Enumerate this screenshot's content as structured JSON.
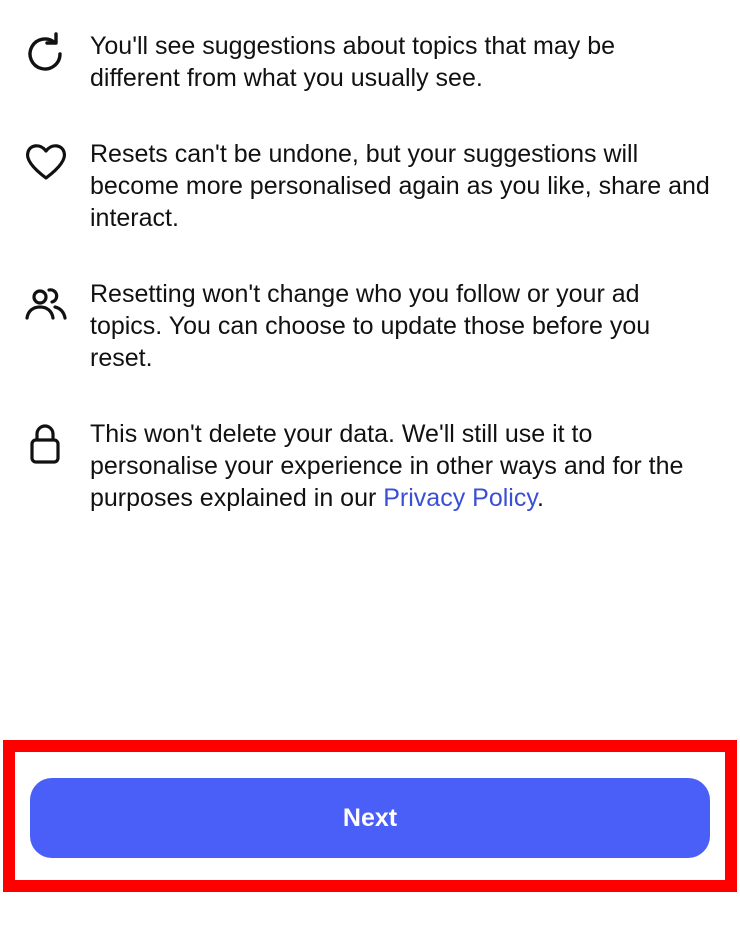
{
  "items": [
    {
      "icon": "refresh-icon",
      "text": "You'll see suggestions about topics that may be different from what you usually see."
    },
    {
      "icon": "heart-icon",
      "text": "Resets can't be undone, but your suggestions will become more personalised again as you like, share and interact."
    },
    {
      "icon": "people-icon",
      "text": "Resetting won't change who you follow or your ad topics. You can choose to update those before you reset."
    },
    {
      "icon": "lock-icon",
      "text": "This won't delete your data. We'll still use it to personalise your experience in other ways and for the purposes explained in our ",
      "link": "Privacy Policy",
      "suffix": "."
    }
  ],
  "next_button": {
    "label": "Next"
  },
  "colors": {
    "button": "#4a5ff7",
    "link": "#3b4fd6",
    "highlight": "#ff0000"
  }
}
